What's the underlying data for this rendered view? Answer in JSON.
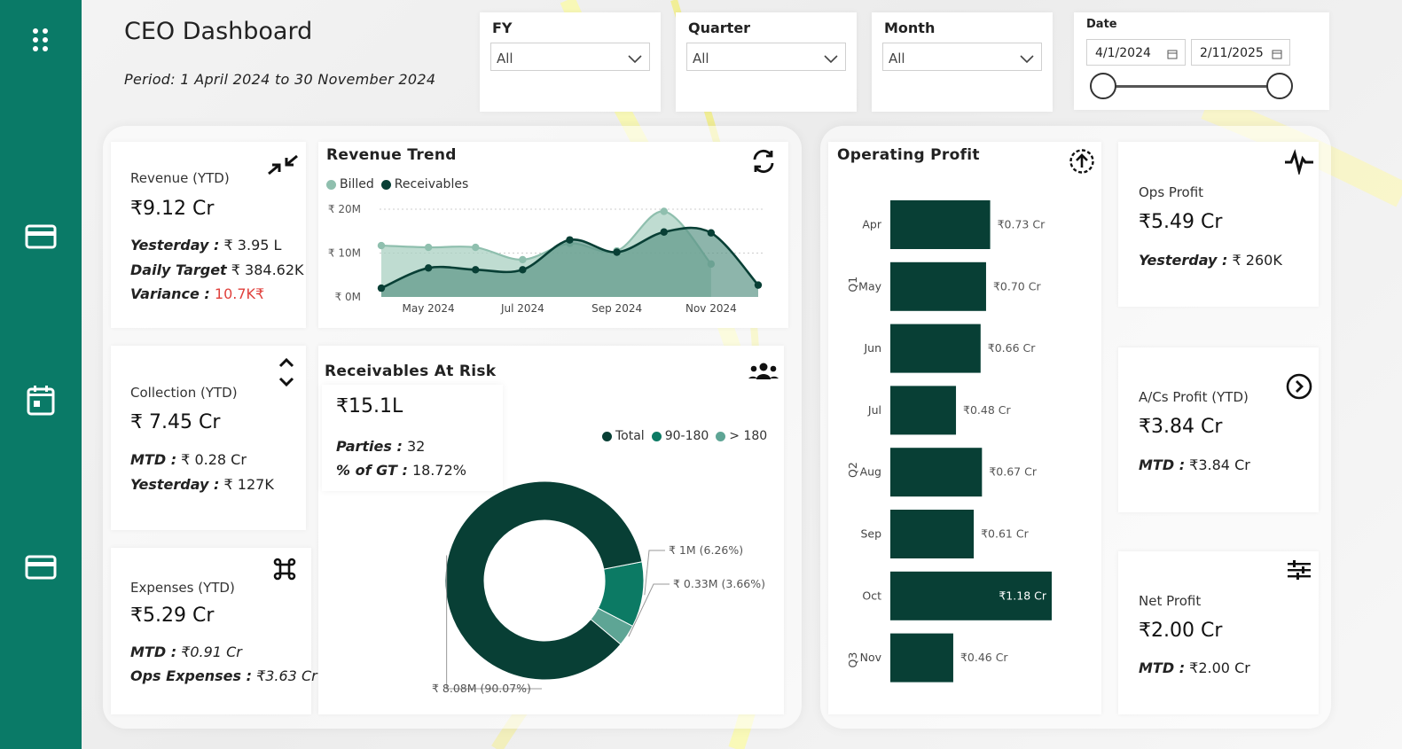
{
  "header": {
    "title": "CEO Dashboard",
    "period": "Period: 1 April 2024 to 30 November 2024"
  },
  "slicers": {
    "fy": {
      "label": "FY",
      "value": "All"
    },
    "quarter": {
      "label": "Quarter",
      "value": "All"
    },
    "month": {
      "label": "Month",
      "value": "All"
    },
    "date": {
      "label": "Date",
      "start": "4/1/2024",
      "end": "2/11/2025",
      "range_start_fraction": 0,
      "range_end_fraction": 1
    }
  },
  "sidebar": {
    "icons": [
      "grid-icon",
      "card-icon",
      "calendar-icon",
      "card-icon"
    ]
  },
  "revenue": {
    "title": "Revenue (YTD)",
    "value": "₹9.12 Cr",
    "yesterday_label": "Yesterday :",
    "yesterday_value": " ₹ 3.95 L",
    "target_label": "Daily Target",
    "target_value": " ₹ 384.62K",
    "variance_label": "Variance :",
    "variance_value": " 10.7K₹"
  },
  "collection": {
    "title": "Collection (YTD)",
    "value": "₹ 7.45 Cr",
    "mtd_label": "MTD :",
    "mtd_value": " ₹ 0.28 Cr",
    "yesterday_label": "Yesterday :",
    "yesterday_value": " ₹ 127K"
  },
  "expenses": {
    "title": "Expenses (YTD)",
    "value": "₹5.29 Cr",
    "mtd_label": "MTD :",
    "mtd_value": " ₹0.91 Cr",
    "ops_label": "Ops Expenses :",
    "ops_value": " ₹3.63 Cr"
  },
  "receivables": {
    "title": "Receivables At Risk",
    "value": "₹15.1L",
    "parties_label": "Parties :",
    "parties_value": " 32",
    "gt_label": "% of GT :",
    "gt_value": " 18.72%"
  },
  "ops_profit": {
    "title": "Ops Profit",
    "value": "₹5.49 Cr",
    "yesterday_label": "Yesterday :",
    "yesterday_value": " ₹ 260K"
  },
  "acs_profit": {
    "title": "A/Cs Profit (YTD)",
    "value": "₹3.84 Cr",
    "mtd_label": "MTD :",
    "mtd_value": " ₹3.84 Cr"
  },
  "net_profit": {
    "title": "Net Profit",
    "value": "₹2.00 Cr",
    "mtd_label": "MTD :",
    "mtd_value": " ₹2.00 Cr"
  },
  "colors": {
    "sidebar": "#0a7a67",
    "dark_green": "#083f35",
    "mid_green": "#0c7a64",
    "light_green": "#8fbfae",
    "negative": "#e0403c"
  },
  "chart_data": [
    {
      "id": "revenue_trend",
      "type": "area",
      "title": "Revenue Trend",
      "x_ticks": [
        "May 2024",
        "Jul 2024",
        "Sep 2024",
        "Nov 2024"
      ],
      "y_ticks": [
        "₹ 0M",
        "₹ 10M",
        "₹ 20M"
      ],
      "ylim": [
        0,
        20
      ],
      "x": [
        "Apr 2024",
        "May 2024",
        "Jun 2024",
        "Jul 2024",
        "Aug 2024",
        "Sep 2024",
        "Oct 2024",
        "Nov 2024",
        "Dec 2024"
      ],
      "series": [
        {
          "name": "Billed",
          "color": "#8fbfae",
          "values": [
            11.7,
            11.3,
            11.3,
            8.5,
            12.2,
            10.5,
            19.5,
            7.5,
            null
          ]
        },
        {
          "name": "Receivables",
          "color": "#083f35",
          "values": [
            2.0,
            6.6,
            6.2,
            6.2,
            13.0,
            10.2,
            14.8,
            14.6,
            2.7
          ]
        }
      ]
    },
    {
      "id": "receivables_donut",
      "type": "pie",
      "legend": [
        "Total",
        "90-180",
        "> 180"
      ],
      "legend_colors": [
        "#083f35",
        "#0c7a64",
        "#5ea595"
      ],
      "slices": [
        {
          "name": "Total",
          "value": 8.08,
          "percent": 90.07,
          "label": "₹ 8.08M (90.07%)",
          "color": "#083f35"
        },
        {
          "name": "90-180",
          "value": 1.0,
          "percent": 6.26,
          "label": "₹ 1M (6.26%)",
          "color": "#0c7a64"
        },
        {
          "name": "> 180",
          "value": 0.33,
          "percent": 3.66,
          "label": "₹ 0.33M (3.66%)",
          "color": "#5ea595"
        }
      ]
    },
    {
      "id": "operating_profit",
      "type": "bar",
      "title": "Operating Profit",
      "orientation": "horizontal",
      "categories": [
        "Apr",
        "May",
        "Jun",
        "Jul",
        "Aug",
        "Sep",
        "Oct",
        "Nov"
      ],
      "groups": [
        {
          "label": "Q1",
          "categories": [
            "Apr",
            "May",
            "Jun"
          ]
        },
        {
          "label": "Q2",
          "categories": [
            "Jul",
            "Aug",
            "Sep"
          ]
        },
        {
          "label": "Q3",
          "categories": [
            "Oct",
            "Nov"
          ]
        }
      ],
      "values": [
        0.73,
        0.7,
        0.66,
        0.48,
        0.67,
        0.61,
        1.18,
        0.46
      ],
      "labels": [
        "₹0.73 Cr",
        "₹0.70 Cr",
        "₹0.66 Cr",
        "₹0.48 Cr",
        "₹0.67 Cr",
        "₹0.61 Cr",
        "₹1.18 Cr",
        "₹0.46 Cr"
      ],
      "color": "#083f35"
    }
  ]
}
